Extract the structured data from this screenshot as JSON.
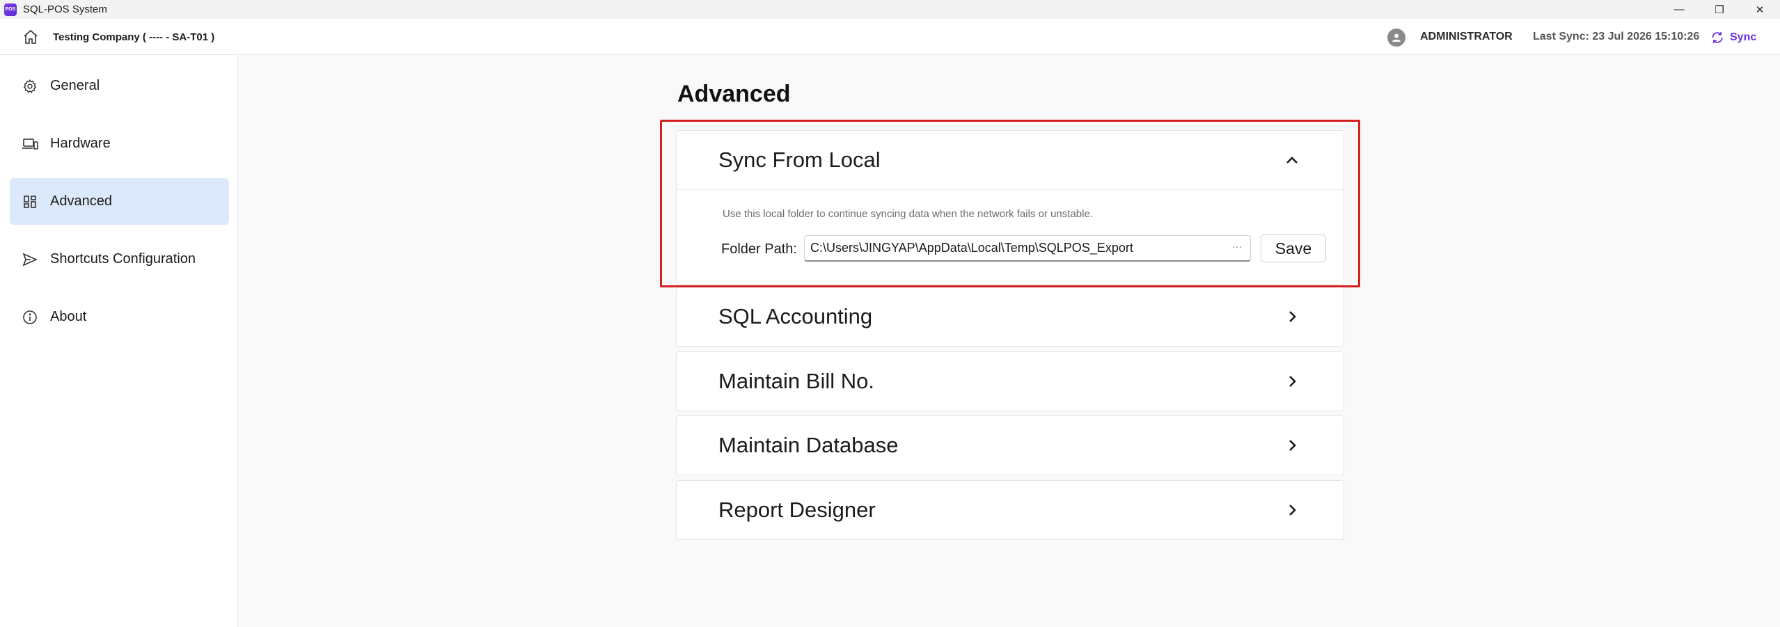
{
  "window": {
    "title": "SQL-POS System",
    "app_icon_text": "POS",
    "minimize": "—",
    "restore": "❐",
    "close": "✕"
  },
  "header": {
    "company": "Testing Company ( ---- - SA-T01 )",
    "user": "ADMINISTRATOR",
    "last_sync": "Last Sync: 23 Jul 2026 15:10:26",
    "sync_label": "Sync"
  },
  "sidebar": {
    "items": [
      {
        "label": "General",
        "icon": "gear-icon"
      },
      {
        "label": "Hardware",
        "icon": "devices-icon"
      },
      {
        "label": "Advanced",
        "icon": "grid-icon",
        "active": true
      },
      {
        "label": "Shortcuts Configuration",
        "icon": "send-icon"
      },
      {
        "label": "About",
        "icon": "info-icon"
      }
    ]
  },
  "main": {
    "title": "Advanced",
    "sections": [
      {
        "title": "Sync From Local",
        "expanded": true,
        "hint": "Use this local folder to continue syncing data when the network fails or unstable.",
        "folder_label": "Folder Path:",
        "folder_value": "C:\\Users\\JINGYAP\\AppData\\Local\\Temp\\SQLPOS_Export",
        "browse_label": "···",
        "save_label": "Save"
      },
      {
        "title": "SQL Accounting",
        "expanded": false
      },
      {
        "title": "Maintain Bill No.",
        "expanded": false
      },
      {
        "title": "Maintain Database",
        "expanded": false
      },
      {
        "title": "Report Designer",
        "expanded": false
      }
    ]
  },
  "colors": {
    "accent": "#6a2fe0",
    "active_nav": "#dce9fb",
    "highlight_border": "#d61f1f"
  }
}
